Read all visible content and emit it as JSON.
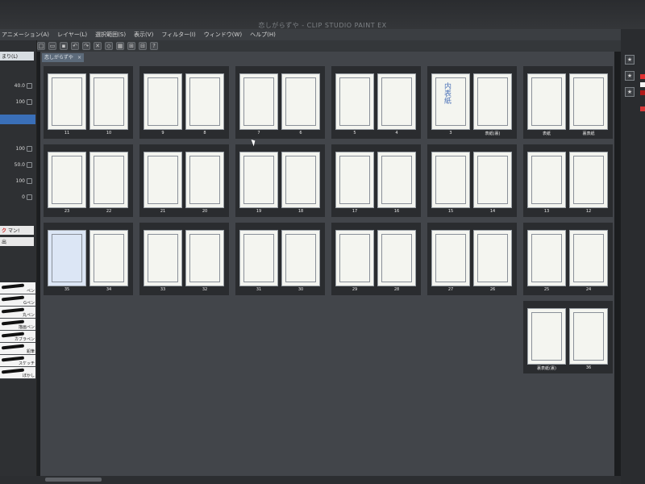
{
  "window": {
    "title": "恋しがらずや - CLIP STUDIO PAINT EX"
  },
  "menu": [
    "アニメーション(A)",
    "レイヤー(L)",
    "選択範囲(S)",
    "表示(V)",
    "フィルター(I)",
    "ウィンドウ(W)",
    "ヘルプ(H)"
  ],
  "document_tab": {
    "label": "恋しがらずや",
    "close": "×"
  },
  "left_panel": {
    "brush_size_label": "まり(L)",
    "values": [
      "40.0",
      "100",
      "100",
      "50.0",
      "100",
      "0"
    ],
    "brush_tab_label": "マン!",
    "brush_section": "出",
    "brushes": [
      "ペン",
      "Gペン",
      "丸ペン",
      "描画ペン",
      "カブラペン",
      "鉛筆",
      "スケッチ",
      "ぼかし"
    ]
  },
  "spreads": [
    {
      "left": "11",
      "right": "10"
    },
    {
      "left": "9",
      "right": "8"
    },
    {
      "left": "7",
      "right": "6"
    },
    {
      "left": "5",
      "right": "4"
    },
    {
      "left": "3",
      "right": "表紙(裏)"
    },
    {
      "left": "表紙",
      "right": "裏表紙"
    },
    {
      "left": "23",
      "right": "22"
    },
    {
      "left": "21",
      "right": "20"
    },
    {
      "left": "19",
      "right": "18"
    },
    {
      "left": "17",
      "right": "16"
    },
    {
      "left": "15",
      "right": "14"
    },
    {
      "left": "13",
      "right": "12"
    },
    {
      "left": "35",
      "right": "34"
    },
    {
      "left": "33",
      "right": "32"
    },
    {
      "left": "31",
      "right": "30"
    },
    {
      "left": "29",
      "right": "28"
    },
    {
      "left": "27",
      "right": "26"
    },
    {
      "left": "25",
      "right": "24"
    },
    {
      "left": "裏表紙(裏)",
      "right": "36"
    }
  ],
  "sketch": {
    "text": "内表紙"
  },
  "colors": {
    "selection": "#dce6f5",
    "accent": "#5c6a7a"
  }
}
